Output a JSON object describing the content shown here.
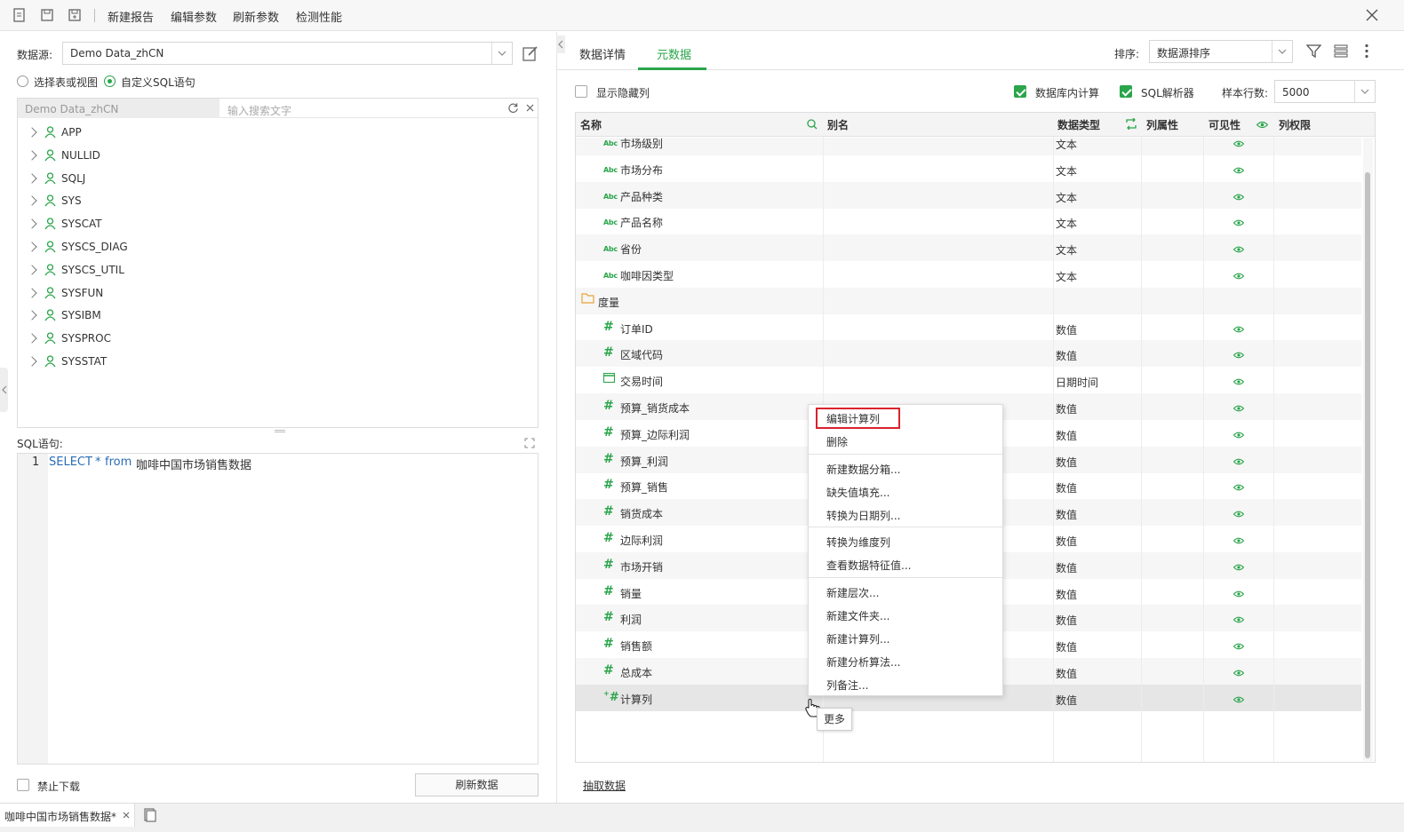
{
  "toolbar": {
    "new_report": "新建报告",
    "edit_params": "编辑参数",
    "refresh_params": "刷新参数",
    "check_performance": "检测性能"
  },
  "left": {
    "datasource_label": "数据源:",
    "datasource_value": "Demo Data_zhCN",
    "radio_table": "选择表或视图",
    "radio_sql": "自定义SQL语句",
    "tree_source": "Demo Data_zhCN",
    "search_placeholder": "输入搜索文字",
    "schemas": [
      "APP",
      "NULLID",
      "SQLJ",
      "SYS",
      "SYSCAT",
      "SYSCS_DIAG",
      "SYSCS_UTIL",
      "SYSFUN",
      "SYSIBM",
      "SYSPROC",
      "SYSSTAT"
    ],
    "sql_label": "SQL语句:",
    "sql_line_no": "1",
    "sql_kw_select": "SELECT",
    "sql_star": "*",
    "sql_kw_from": "from",
    "sql_table": "咖啡中国市场销售数据",
    "disable_download": "禁止下载",
    "refresh_data": "刷新数据"
  },
  "right": {
    "tab_detail": "数据详情",
    "tab_meta": "元数据",
    "sort_label": "排序:",
    "sort_value": "数据源排序",
    "show_hidden": "显示隐藏列",
    "db_compute": "数据库内计算",
    "sql_parser": "SQL解析器",
    "sample_rows_label": "样本行数:",
    "sample_rows_value": "5000",
    "col_name": "名称",
    "col_alias": "别名",
    "col_type": "数据类型",
    "col_attr": "列属性",
    "col_visible": "可见性",
    "col_permission": "列权限",
    "rows": [
      {
        "name": "市场级别",
        "type": "文本",
        "icon": "text-type-icon"
      },
      {
        "name": "市场分布",
        "type": "文本",
        "icon": "text-type-icon"
      },
      {
        "name": "产品种类",
        "type": "文本",
        "icon": "text-type-icon"
      },
      {
        "name": "产品名称",
        "type": "文本",
        "icon": "text-type-icon"
      },
      {
        "name": "省份",
        "type": "文本",
        "icon": "text-type-icon"
      },
      {
        "name": "咖啡因类型",
        "type": "文本",
        "icon": "text-type-icon"
      },
      {
        "name": "度量",
        "type": "",
        "icon": "folder-icon"
      },
      {
        "name": "订单ID",
        "type": "数值",
        "icon": "number-type-icon"
      },
      {
        "name": "区域代码",
        "type": "数值",
        "icon": "number-type-icon"
      },
      {
        "name": "交易时间",
        "type": "日期时间",
        "icon": "calendar-icon"
      },
      {
        "name": "预算_销货成本",
        "type": "数值",
        "icon": "number-type-icon"
      },
      {
        "name": "预算_边际利润",
        "type": "数值",
        "icon": "number-type-icon"
      },
      {
        "name": "预算_利润",
        "type": "数值",
        "icon": "number-type-icon"
      },
      {
        "name": "预算_销售",
        "type": "数值",
        "icon": "number-type-icon"
      },
      {
        "name": "销货成本",
        "type": "数值",
        "icon": "number-type-icon"
      },
      {
        "name": "边际利润",
        "type": "数值",
        "icon": "number-type-icon"
      },
      {
        "name": "市场开销",
        "type": "数值",
        "icon": "number-type-icon"
      },
      {
        "name": "销量",
        "type": "数值",
        "icon": "number-type-icon"
      },
      {
        "name": "利润",
        "type": "数值",
        "icon": "number-type-icon"
      },
      {
        "name": "销售额",
        "type": "数值",
        "icon": "number-type-icon"
      },
      {
        "name": "总成本",
        "type": "数值",
        "icon": "number-type-icon"
      },
      {
        "name": "计算列",
        "type": "数值",
        "icon": "calc-column-icon"
      }
    ],
    "extract_data": "抽取数据",
    "tooltip_more": "更多"
  },
  "context_menu": {
    "items": [
      "编辑计算列",
      "删除",
      "新建数据分箱...",
      "缺失值填充...",
      "转换为日期列...",
      "转换为维度列",
      "查看数据特征值...",
      "新建层次...",
      "新建文件夹...",
      "新建计算列...",
      "新建分析算法...",
      "列备注..."
    ]
  },
  "bottom_tab": {
    "label": "咖啡中国市场销售数据*"
  },
  "colors": {
    "accent": "#2aa54b",
    "sql_keyword": "#2b6cb5",
    "highlight_border": "#d9232e"
  }
}
